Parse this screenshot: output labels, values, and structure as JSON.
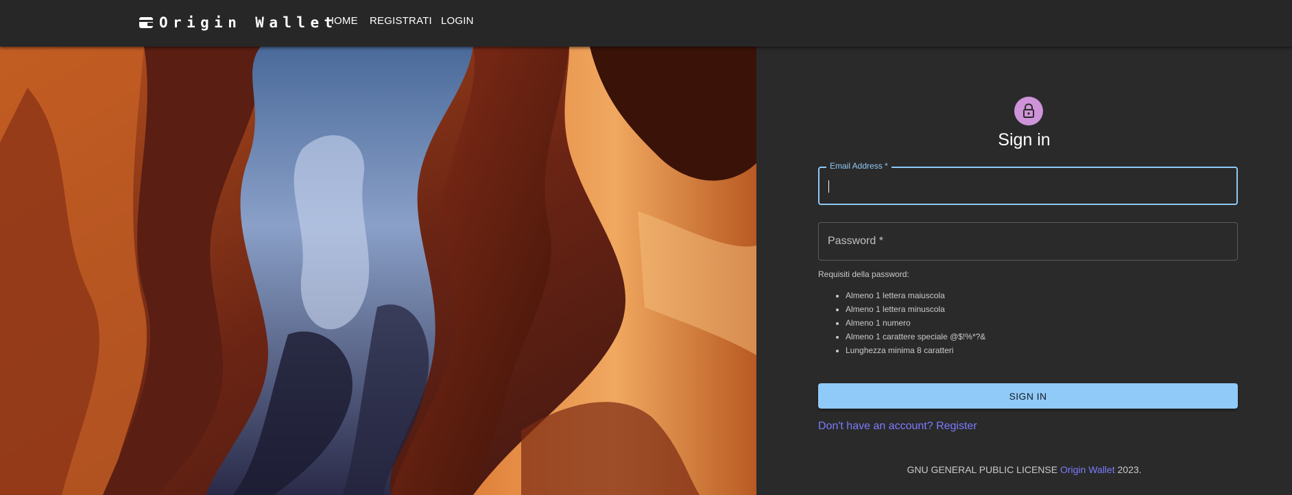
{
  "header": {
    "brand": "Origin Wallet",
    "brand_icon": "wallet-icon",
    "nav": [
      "HOME",
      "REGISTRATI",
      "LOGIN"
    ]
  },
  "hero": {
    "image": "antelope-canyon-photo"
  },
  "form": {
    "icon": "lock-icon",
    "title": "Sign in",
    "email_label": "Email Address *",
    "email_value": "",
    "password_label": "Password *",
    "password_value": "",
    "requirements_title": "Requisiti della password:",
    "requirements": [
      "Almeno 1 lettera maiuscola",
      "Almeno 1 lettera minuscola",
      "Almeno 1 numero",
      "Almeno 1 carattere speciale @$!%*?&",
      "Lunghezza minima 8 caratteri"
    ],
    "submit_label": "SIGN IN",
    "register_link": "Don't have an account? Register"
  },
  "footer": {
    "license": "GNU GENERAL PUBLIC LICENSE",
    "link": "Origin Wallet",
    "year": "2023."
  },
  "colors": {
    "appbar": "#272727",
    "panel": "#2a2a2a",
    "primary": "#90caf9",
    "avatar": "#ce93d8",
    "link": "#7c7cff"
  }
}
